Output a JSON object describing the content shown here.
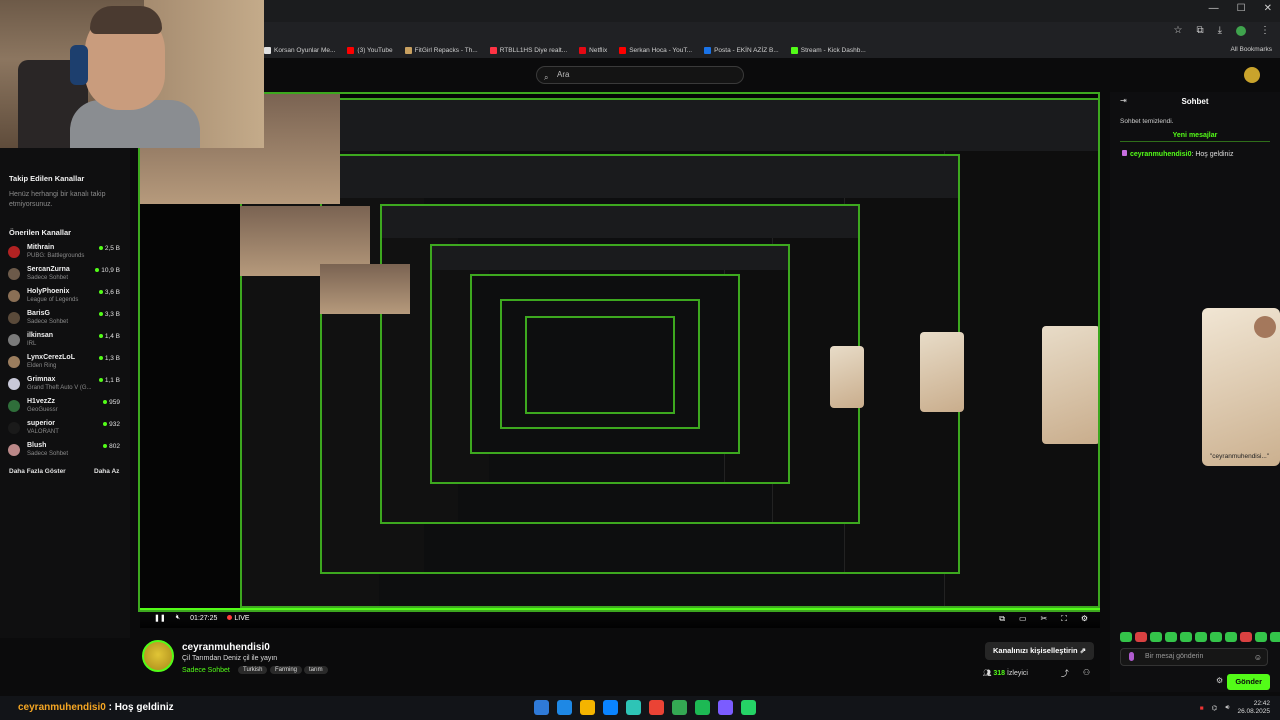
{
  "browser": {
    "bookmarks": [
      {
        "label": "Korsan Oyunlar Me...",
        "color": "#e0e0e0"
      },
      {
        "label": "(3) YouTube",
        "color": "#ff0000"
      },
      {
        "label": "FitGirl Repacks - Th...",
        "color": "#c8a060"
      },
      {
        "label": "RTBLL1HS Diye realt...",
        "color": "#ff3344"
      },
      {
        "label": "Netflix",
        "color": "#e50914"
      },
      {
        "label": "Serkan Hoca - YouT...",
        "color": "#ff0000"
      },
      {
        "label": "Posta - EKİN AZİZ B...",
        "color": "#1a73e8"
      },
      {
        "label": "Stream - Kick Dashb...",
        "color": "#53fc18"
      }
    ],
    "all_bookmarks": "All Bookmarks"
  },
  "search": {
    "placeholder": "Ara"
  },
  "sidebar": {
    "followed_title": "Takip Edilen Kanallar",
    "followed_empty": "Henüz herhangi bir kanalı takip etmiyorsunuz.",
    "recommended_title": "Önerilen Kanallar",
    "channels": [
      {
        "name": "Mithrain",
        "category": "PUBG: Battlegrounds",
        "viewers": "2,5 B",
        "avatar": "#b22222"
      },
      {
        "name": "SercanZurna",
        "category": "Sadece Sohbet",
        "viewers": "10,9 B",
        "avatar": "#6c5a4a"
      },
      {
        "name": "HolyPhoenix",
        "category": "League of Legends",
        "viewers": "3,6 B",
        "avatar": "#8a6f55"
      },
      {
        "name": "BarisG",
        "category": "Sadece Sohbet",
        "viewers": "3,3 B",
        "avatar": "#5a4a3a"
      },
      {
        "name": "ilkinsan",
        "category": "IRL",
        "viewers": "1,4 B",
        "avatar": "#7a7a7a"
      },
      {
        "name": "LynxCerezLoL",
        "category": "Elden Ring",
        "viewers": "1,3 B",
        "avatar": "#9b7d5e"
      },
      {
        "name": "Grimnax",
        "category": "Grand Theft Auto V (G...",
        "viewers": "1,1 B",
        "avatar": "#c8c8d8"
      },
      {
        "name": "H1vezZz",
        "category": "GeoGuessr",
        "viewers": "959",
        "avatar": "#2f6e3a"
      },
      {
        "name": "superior",
        "category": "VALORANT",
        "viewers": "932",
        "avatar": "#1a1a1a"
      },
      {
        "name": "Blush",
        "category": "Sadece Sohbet",
        "viewers": "802",
        "avatar": "#b88"
      }
    ],
    "show_more": "Daha Fazla Göster",
    "show_less": "Daha Az"
  },
  "player": {
    "time": "01:27:25",
    "live": "LIVE",
    "progress": 1.0
  },
  "stream": {
    "channel": "ceyranmuhendisi0",
    "title": "Çil Tarımdan Deniz çil ile yayın",
    "category": "Sadece Sohbet",
    "tags": [
      "Turkish",
      "Farming",
      "tarım"
    ],
    "customize": "Kanalınızı kişiselleştirin",
    "viewers_count": "318",
    "viewers_label": "İzleyici"
  },
  "chat": {
    "title": "Sohbet",
    "cleared": "Sohbet temizlendi.",
    "new_messages": "Yeni mesajlar",
    "messages": [
      {
        "user": "ceyranmuhendisi0",
        "text": ": Hoş geldiniz"
      }
    ],
    "input_placeholder": "Bir mesaj gönderin",
    "send": "Gönder",
    "facecam_caption": "\"ceyranmuhendisi...\""
  },
  "overlay": {
    "user": "ceyranmuhendisi0",
    "text": " : Hoş geldiniz"
  },
  "taskbar": {
    "time": "22:42",
    "date": "26.08.2025",
    "app_colors": [
      "#2f7ad8",
      "#1e88e5",
      "#f4b400",
      "#0a84ff",
      "#2ec4b6",
      "#ea4335",
      "#34a853",
      "#1db954",
      "#7b5cff",
      "#25d366"
    ]
  }
}
